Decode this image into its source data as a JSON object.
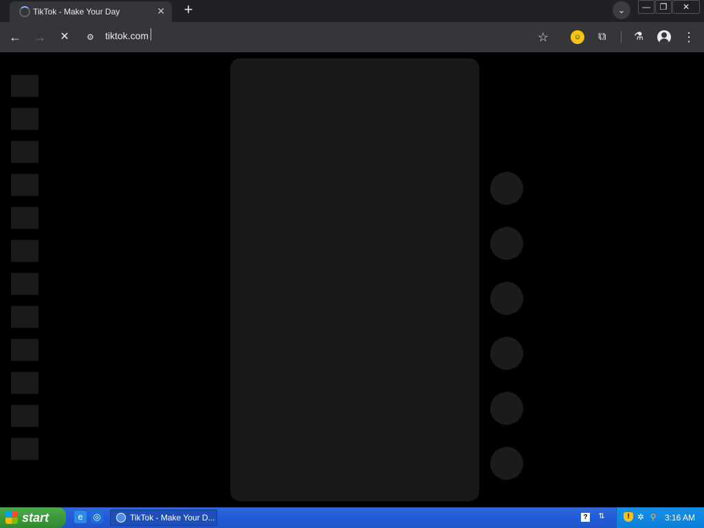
{
  "browser": {
    "tab": {
      "title": "TikTok - Make Your Day",
      "close_glyph": "✕",
      "icon": "loading-spinner-icon"
    },
    "new_tab_glyph": "+",
    "tab_search_glyph": "⌄",
    "window_controls": {
      "minimize": "—",
      "maximize": "❐",
      "close": "✕"
    },
    "toolbar": {
      "back_glyph": "←",
      "forward_glyph": "→",
      "stop_glyph": "✕",
      "site_info_glyph": "⚙",
      "url": "tiktok.com",
      "star_glyph": "☆",
      "extension_glyph": "☺",
      "puzzle_glyph": "⧉",
      "labs_glyph": "⚗",
      "menu_glyph": "⋮"
    }
  },
  "page": {
    "state": "loading-skeleton",
    "placeholder_color": "#1a1a1a"
  },
  "taskbar": {
    "start_label": "start",
    "quick_launch": [
      {
        "icon": "internet-explorer-icon",
        "glyph": "e"
      },
      {
        "icon": "browser-icon",
        "glyph": "◎"
      }
    ],
    "task_label": "TikTok - Make Your D...",
    "help_glyph": "?",
    "restore_glyph": "⇅",
    "tray": {
      "shield_glyph": "!",
      "network_glyph": "✲",
      "search_glyph": "⚲",
      "clock": "3:16 AM"
    }
  }
}
